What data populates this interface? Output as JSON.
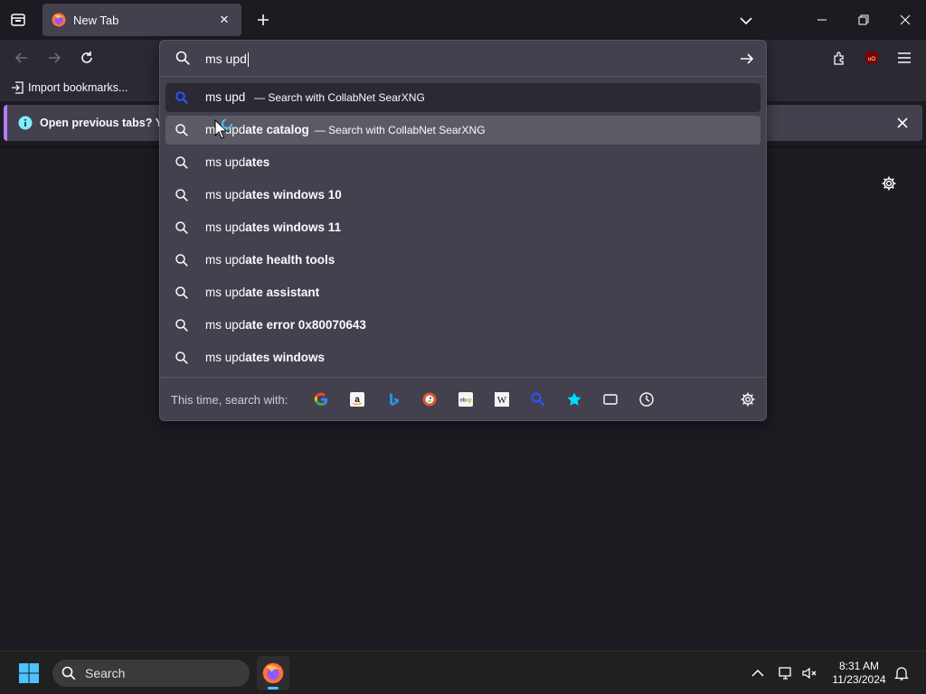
{
  "tab": {
    "title": "New Tab"
  },
  "bookmarks": {
    "import_label": "Import bookmarks..."
  },
  "notification": {
    "text": "Open previous tabs? You c"
  },
  "urlbar": {
    "typed_text": "ms upd",
    "heuristic": {
      "typed": "ms upd",
      "action": "— Search with CollabNet SearXNG"
    },
    "suggestions": [
      {
        "typed": "ms upd",
        "rest": "ate catalog",
        "action": "— Search with CollabNet SearXNG"
      },
      {
        "typed": "ms upd",
        "rest": "ates",
        "action": ""
      },
      {
        "typed": "ms upd",
        "rest": "ates windows 10",
        "action": ""
      },
      {
        "typed": "ms upd",
        "rest": "ates windows 11",
        "action": ""
      },
      {
        "typed": "ms upd",
        "rest": "ate health tools",
        "action": ""
      },
      {
        "typed": "ms upd",
        "rest": "ate assistant",
        "action": ""
      },
      {
        "typed": "ms upd",
        "rest": "ate error 0x80070643",
        "action": ""
      },
      {
        "typed": "ms upd",
        "rest": "ates windows",
        "action": ""
      }
    ],
    "oneoff_label": "This time, search with:",
    "engines": [
      "google-icon",
      "amazon-icon",
      "bing-icon",
      "duckduckgo-icon",
      "ebay-icon",
      "wikipedia-icon",
      "searxng-icon",
      "bookmarks-icon",
      "tabs-icon",
      "history-icon"
    ]
  },
  "taskbar": {
    "search_placeholder": "Search",
    "time": "8:31 AM",
    "date": "11/23/2024"
  },
  "colors": {
    "accent": "#4cc2ff",
    "notification_bar": "#b27cf5",
    "ublock": "#800000"
  }
}
